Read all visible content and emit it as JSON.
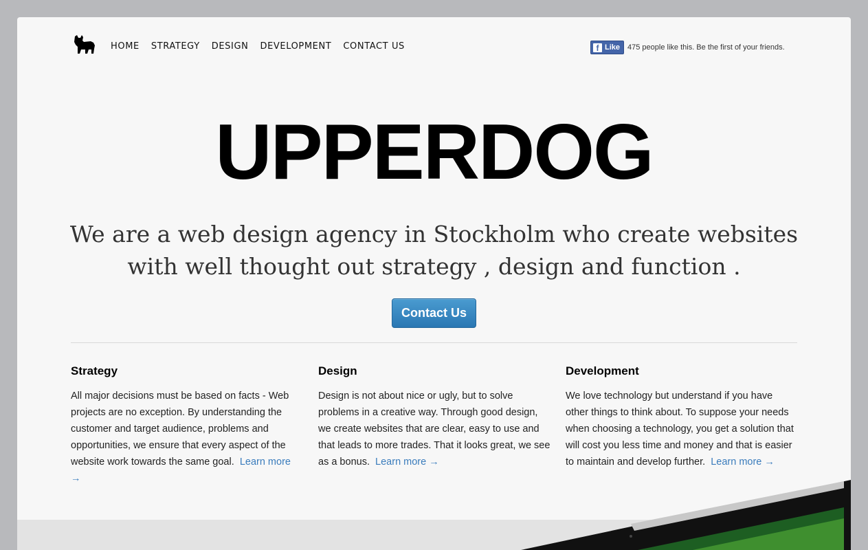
{
  "nav": {
    "logo_icon": "bulldog-icon",
    "items": [
      {
        "label": "HOME"
      },
      {
        "label": "STRATEGY"
      },
      {
        "label": "DESIGN"
      },
      {
        "label": "DEVELOPMENT"
      },
      {
        "label": "CONTACT US"
      }
    ]
  },
  "facebook": {
    "icon": "facebook-f-icon",
    "button_label": "Like",
    "text": "475 people like this. Be the first of your friends.",
    "color": "#4465a9"
  },
  "hero": {
    "title": "UPPERDOG",
    "subtitle": "We are a web design agency in Stockholm who create websites with well thought out strategy , design and function .",
    "cta_label": "Contact Us",
    "cta_color": "#2a77b3"
  },
  "columns": [
    {
      "heading": "Strategy",
      "body": "All major decisions must be based on facts - Web projects are no exception. By understanding the customer and target audience, problems and opportunities, we ensure that every aspect of the website work towards the same goal.",
      "link": "Learn more →"
    },
    {
      "heading": "Design",
      "body": "Design is not about nice or ugly, but to solve problems in a creative way. Through good design, we create websites that are clear, easy to use and that leads to more trades. That it looks great, we see as a bonus.",
      "link": "Learn more →"
    },
    {
      "heading": "Development",
      "body": "We love technology but understand if you have other things to think about. To suppose your needs when choosing a technology, you get a solution that will cost you less time and money and that is easier to maintain and develop further.",
      "link": "Learn more →"
    }
  ],
  "link_color": "#3a7cbc"
}
